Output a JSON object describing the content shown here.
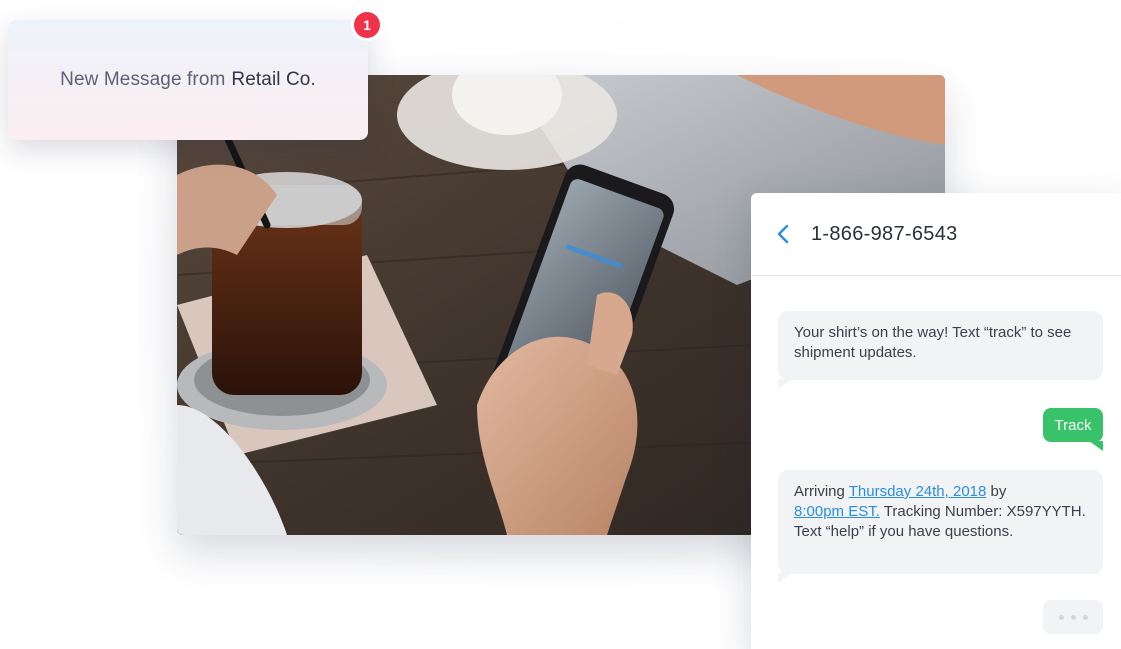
{
  "notification": {
    "text": "New Message from",
    "brand": "Retail Co.",
    "badge_count": "1"
  },
  "photo": {
    "icon": "photo-person-holding-phone-with-iced-coffee"
  },
  "chat": {
    "back_icon": "chevron-left-icon",
    "phone_number": "1-866-987-6543",
    "messages": [
      {
        "direction": "incoming",
        "text": "Your shirt’s on the way! Text “track” to see shipment updates."
      },
      {
        "direction": "outgoing",
        "text": "Track"
      },
      {
        "direction": "incoming",
        "prefix": "Arriving ",
        "date_link": "Thursday 24th, 2018",
        "mid": " by",
        "time_link": "8:00pm  EST.",
        "suffix": " Tracking Number: X597YYTH. Text “help” if you have questions."
      }
    ],
    "typing_indicator": true
  },
  "colors": {
    "accent_link": "#2a8ee0",
    "outgoing_bubble": "#38c26a",
    "badge": "#ef3348",
    "incoming_bubble": "#f2f3f5"
  }
}
